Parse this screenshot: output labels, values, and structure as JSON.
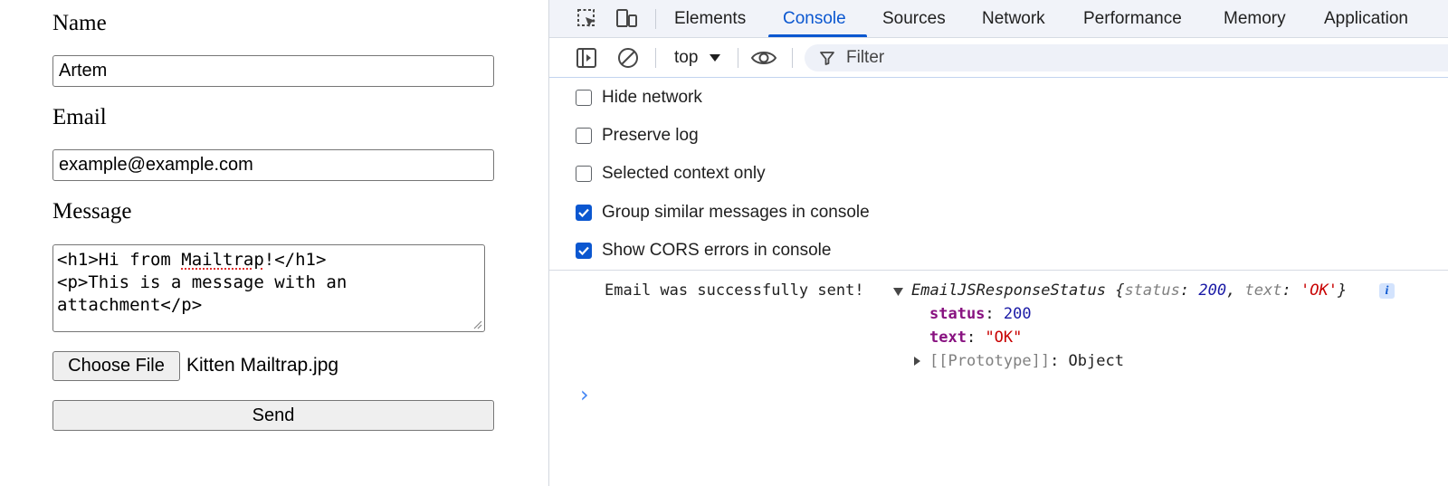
{
  "form": {
    "name_label": "Name",
    "name_value": "Artem",
    "email_label": "Email",
    "email_value": "example@example.com",
    "message_label": "Message",
    "message_lines": [
      "<h1>Hi from ",
      "Mailtrap",
      "!</h1>",
      "<p>This is a message with an",
      "attachment</p>"
    ],
    "choose_file_label": "Choose File",
    "file_name": "Kitten Mailtrap.jpg",
    "send_label": "Send"
  },
  "devtools": {
    "tabs": [
      "Elements",
      "Console",
      "Sources",
      "Network",
      "Performance",
      "Memory",
      "Application"
    ],
    "active_tab": "Console",
    "context": "top",
    "filter_placeholder": "Filter",
    "settings": [
      {
        "label": "Hide network",
        "checked": false
      },
      {
        "label": "Preserve log",
        "checked": false
      },
      {
        "label": "Selected context only",
        "checked": false
      },
      {
        "label": "Group similar messages in console",
        "checked": true
      },
      {
        "label": "Show CORS errors in console",
        "checked": true
      }
    ],
    "console": {
      "message": "Email was successfully sent!",
      "object_name": "EmailJSResponseStatus",
      "preview_open": "{",
      "preview_status_key": "status",
      "preview_status_val": "200",
      "preview_text_key": "text",
      "preview_text_val": "'OK'",
      "preview_close": "}",
      "info_badge": "i",
      "status_key": "status",
      "status_val": "200",
      "text_key": "text",
      "text_val": "\"OK\"",
      "proto_key": "[[Prototype]]",
      "proto_val": "Object",
      "prompt": "›"
    },
    "colors": {
      "accent": "#0b57d0",
      "checkbox_on": "#0b57d0"
    }
  }
}
